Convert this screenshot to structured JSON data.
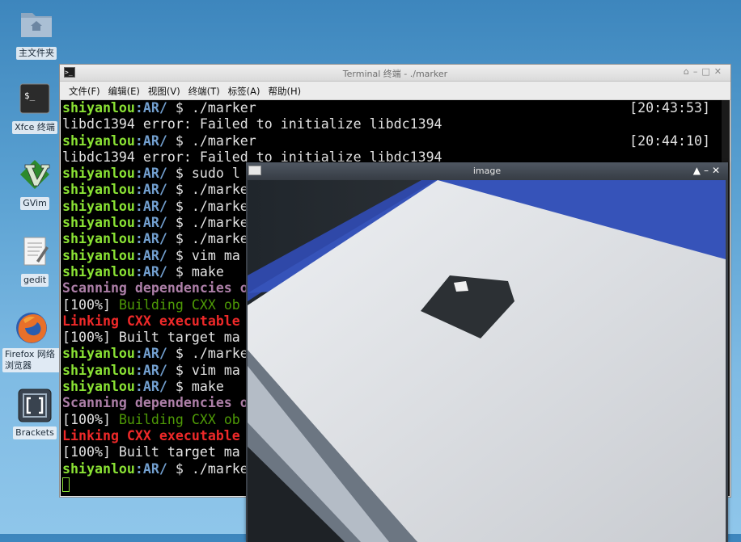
{
  "desktop": {
    "icons": [
      {
        "label": "主文件夹",
        "icon": "home-folder-icon"
      },
      {
        "label": "Xfce 终端",
        "icon": "terminal-icon"
      },
      {
        "label": "GVim",
        "icon": "gvim-icon"
      },
      {
        "label": "gedit",
        "icon": "gedit-icon"
      },
      {
        "label": "Firefox 网络浏览器",
        "icon": "firefox-icon"
      },
      {
        "label": "Brackets",
        "icon": "brackets-icon"
      }
    ]
  },
  "terminal": {
    "title": "Terminal 终端 - ./marker",
    "menu": [
      "文件(F)",
      "编辑(E)",
      "视图(V)",
      "终端(T)",
      "标签(A)",
      "帮助(H)"
    ],
    "prompt_user": "shiyanlou",
    "prompt_path": ":AR/",
    "lines": [
      {
        "type": "prompt",
        "cmd": " $ ./marker",
        "time": "[20:43:53]"
      },
      {
        "type": "text",
        "text": "libdc1394 error: Failed to initialize libdc1394"
      },
      {
        "type": "prompt",
        "cmd": " $ ./marker",
        "time": "[20:44:10]"
      },
      {
        "type": "text",
        "text": "libdc1394 error: Failed to initialize libdc1394"
      },
      {
        "type": "prompt",
        "cmd": " $ sudo l"
      },
      {
        "type": "prompt",
        "cmd": " $ ./marke"
      },
      {
        "type": "prompt",
        "cmd": " $ ./marke"
      },
      {
        "type": "prompt",
        "cmd": " $ ./marke"
      },
      {
        "type": "prompt",
        "cmd": " $ ./marke"
      },
      {
        "type": "prompt",
        "cmd": " $ vim ma"
      },
      {
        "type": "prompt",
        "cmd": " $ make"
      },
      {
        "type": "scan",
        "text": "Scanning dependencies o"
      },
      {
        "type": "build",
        "pct": "[100%]",
        "text": " Building CXX ob"
      },
      {
        "type": "link",
        "text": "Linking CXX executable"
      },
      {
        "type": "text",
        "text": "[100%] Built target ma"
      },
      {
        "type": "prompt",
        "cmd": " $ ./marke"
      },
      {
        "type": "prompt",
        "cmd": " $ vim ma"
      },
      {
        "type": "prompt",
        "cmd": " $ make"
      },
      {
        "type": "scan",
        "text": "Scanning dependencies o"
      },
      {
        "type": "build",
        "pct": "[100%]",
        "text": " Building CXX ob"
      },
      {
        "type": "link",
        "text": "Linking CXX executable"
      },
      {
        "type": "text",
        "text": "[100%] Built target ma"
      },
      {
        "type": "prompt",
        "cmd": " $ ./marke"
      }
    ]
  },
  "image_window": {
    "title": "image"
  },
  "colors": {
    "user": "#8ae234",
    "path": "#729fcf",
    "build": "#4e9a06",
    "link": "#ef2929",
    "scan": "#ad7fa8"
  }
}
